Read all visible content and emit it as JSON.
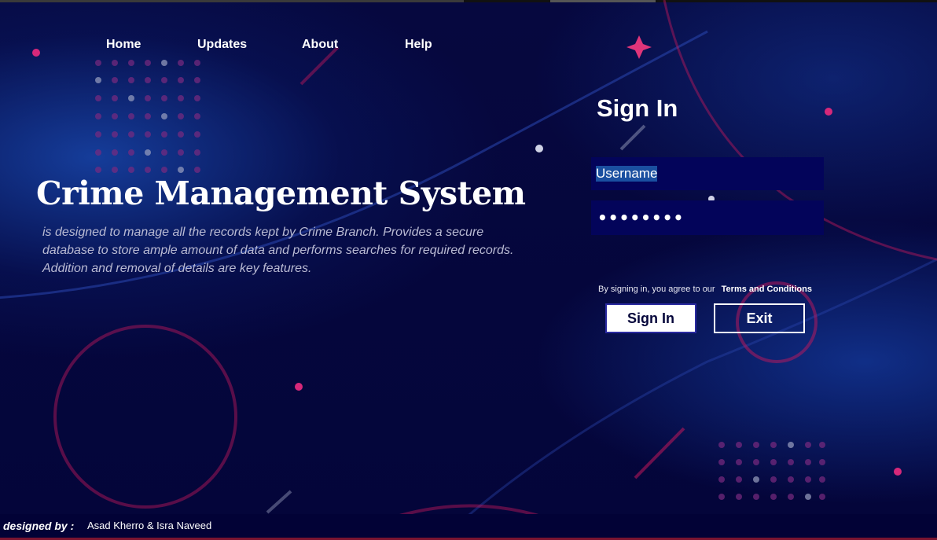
{
  "nav": {
    "items": [
      {
        "label": "Home"
      },
      {
        "label": "Updates"
      },
      {
        "label": "About"
      },
      {
        "label": "Help"
      }
    ]
  },
  "hero": {
    "title": "Crime Management System",
    "description": "is designed  to manage all the records kept by Crime Branch. Provides a secure database to store ample amount of data and performs searches for required records. Addition and removal of details are key features."
  },
  "signin": {
    "title": "Sign In",
    "username_value": "Username",
    "password_value": "••••••••",
    "agree_text": "By signing in, you agree to our",
    "terms_label": "Terms and Conditions",
    "signin_button": "Sign In",
    "exit_button": "Exit"
  },
  "footer": {
    "designed_by_label": "designed by :",
    "designers": "Asad Kherro & Isra Naveed"
  },
  "colors": {
    "background": "#05063a",
    "accent_pink": "#c2185b",
    "field_bg": "#03045a",
    "selection": "#1a4fa0"
  }
}
